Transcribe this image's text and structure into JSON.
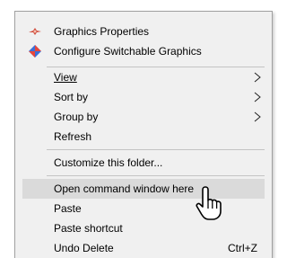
{
  "context_menu": {
    "items": [
      {
        "label": "Graphics Properties",
        "icon": "graphics-properties-icon"
      },
      {
        "label": "Configure Switchable Graphics",
        "icon": "switchable-graphics-icon"
      },
      {
        "label": "View",
        "has_submenu": true
      },
      {
        "label": "Sort by",
        "has_submenu": true
      },
      {
        "label": "Group by",
        "has_submenu": true
      },
      {
        "label": "Refresh"
      },
      {
        "label": "Customize this folder..."
      },
      {
        "label": "Open command window here",
        "highlighted": true
      },
      {
        "label": "Paste"
      },
      {
        "label": "Paste shortcut"
      },
      {
        "label": "Undo Delete",
        "shortcut": "Ctrl+Z"
      }
    ]
  },
  "colors": {
    "menu_background": "#f0f0f0",
    "highlight": "#dadada",
    "border": "#a0a0a0",
    "separator": "#c4c4c4"
  },
  "cursor": {
    "icon": "hand-pointer-icon"
  }
}
